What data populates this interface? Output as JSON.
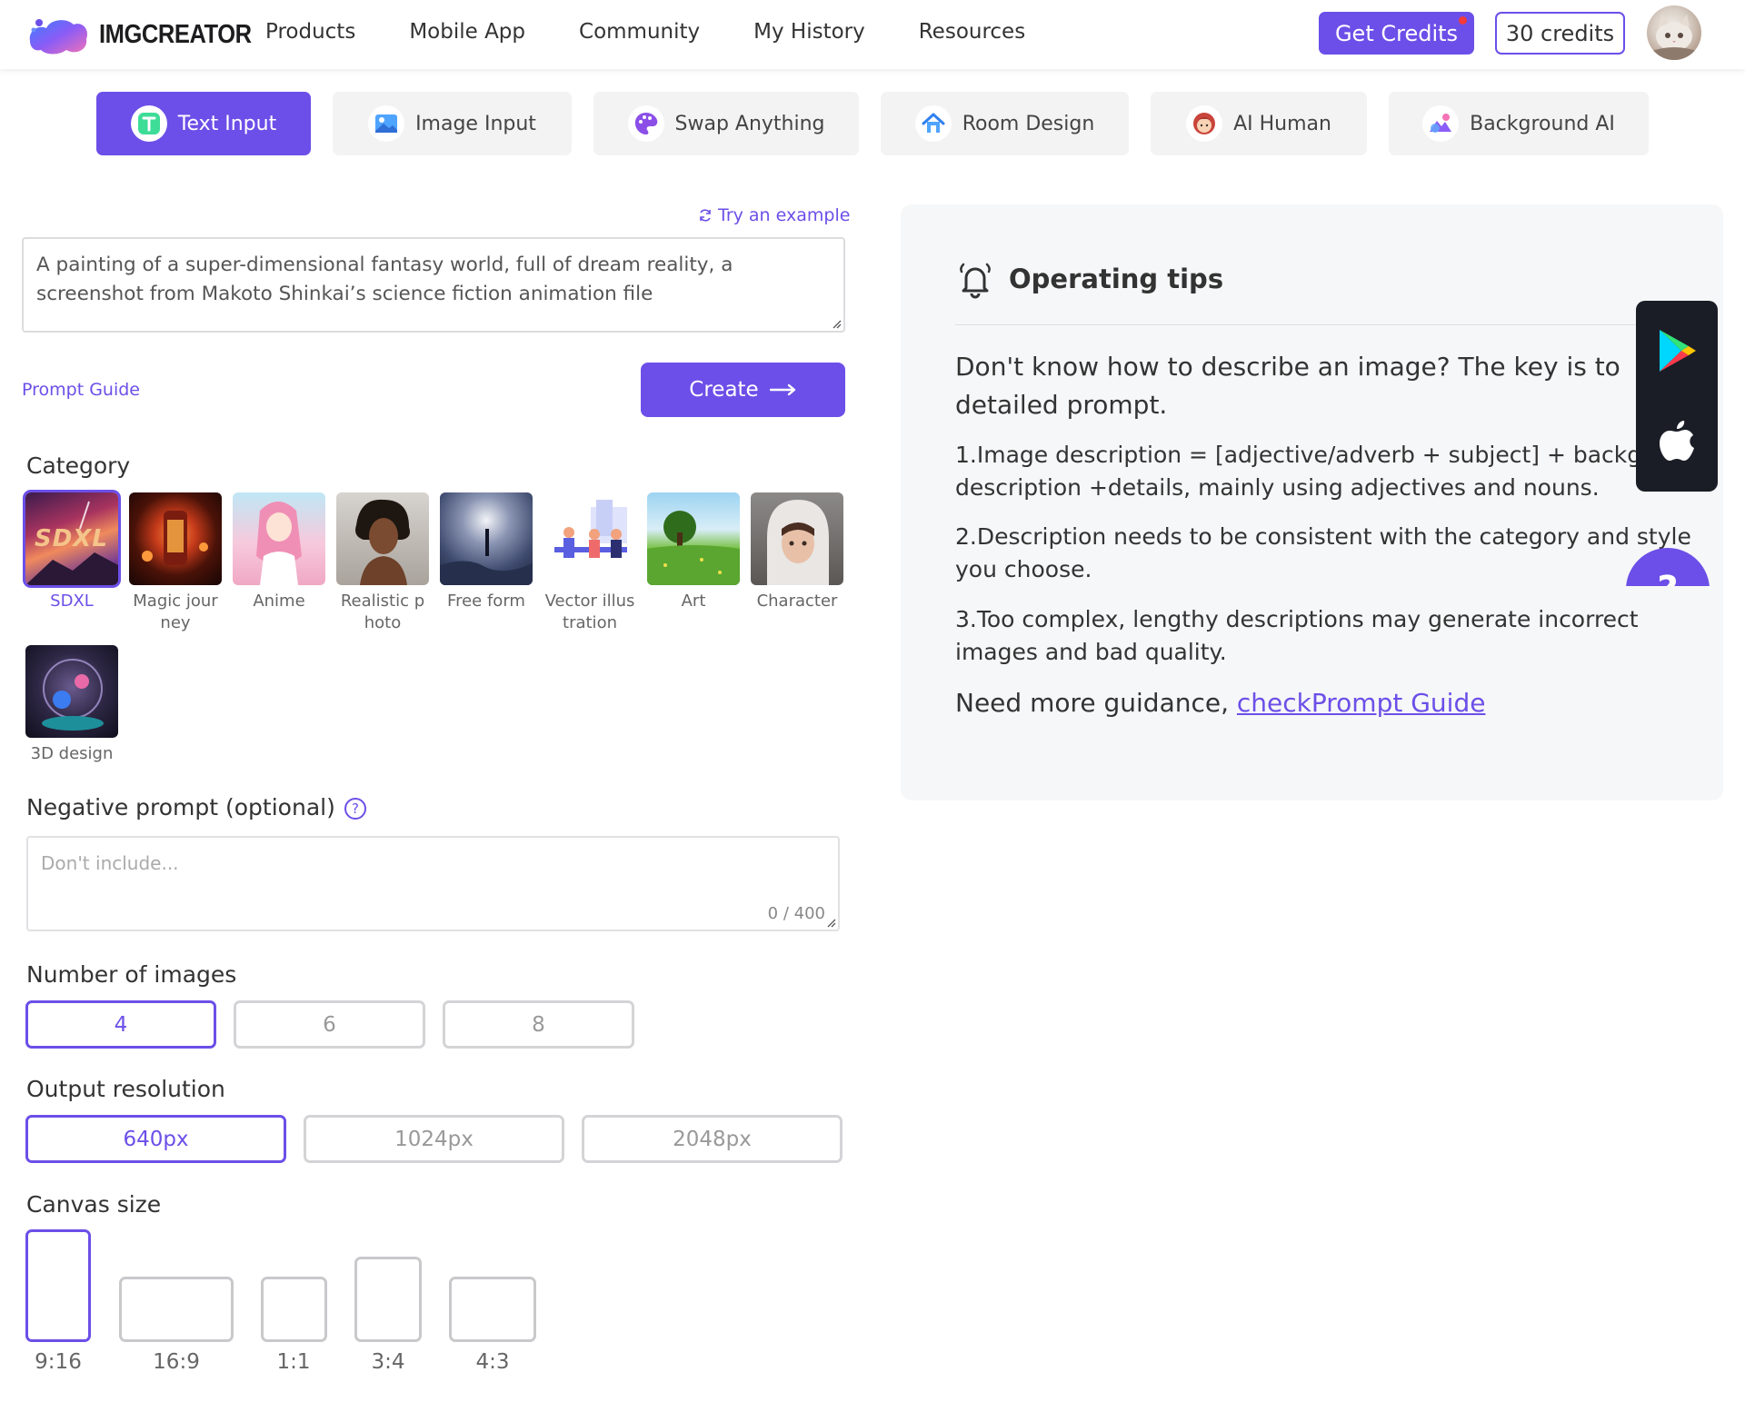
{
  "header": {
    "logo_text": "IMGCREATOR",
    "nav": [
      "Products",
      "Mobile App",
      "Community",
      "My History",
      "Resources"
    ],
    "get_credits": "Get Credits",
    "credits": "30 credits"
  },
  "tabs": [
    {
      "label": "Text Input",
      "icon": "text-input-icon",
      "active": true
    },
    {
      "label": "Image Input",
      "icon": "image-input-icon"
    },
    {
      "label": "Swap Anything",
      "icon": "palette-icon"
    },
    {
      "label": "Room Design",
      "icon": "house-icon"
    },
    {
      "label": "AI Human",
      "icon": "ai-human-icon"
    },
    {
      "label": "Background AI",
      "icon": "background-ai-icon"
    }
  ],
  "prompt": {
    "try_example": "Try an example",
    "text": "A painting of a super-dimensional fantasy world, full of dream reality, a screenshot from Makoto Shinkai’s science fiction animation file",
    "guide_link": "Prompt Guide",
    "create_label": "Create"
  },
  "category": {
    "label": "Category",
    "items": [
      {
        "label": "SDXL",
        "selected": true,
        "badge": "SDXL"
      },
      {
        "label": "Magic jour ney"
      },
      {
        "label": "Anime"
      },
      {
        "label": "Realistic p hoto"
      },
      {
        "label": "Free form"
      },
      {
        "label": "Vector illus tration"
      },
      {
        "label": "Art"
      },
      {
        "label": "Character"
      },
      {
        "label": "3D design"
      }
    ]
  },
  "negative": {
    "label": "Negative prompt (optional)",
    "help": "?",
    "placeholder": "Don't include...",
    "count": "0 / 400"
  },
  "num_images": {
    "label": "Number of images",
    "options": [
      "4",
      "6",
      "8"
    ],
    "selected": "4"
  },
  "resolution": {
    "label": "Output resolution",
    "options": [
      "640px",
      "1024px",
      "2048px"
    ],
    "selected": "640px"
  },
  "canvas": {
    "label": "Canvas size",
    "options": [
      "9:16",
      "16:9",
      "1:1",
      "3:4",
      "4:3"
    ],
    "selected": "9:16"
  },
  "tips": {
    "title": "Operating tips",
    "lead": "Don't know how to describe an image? The key is to write a detailed prompt.",
    "lead_line1": "Don't know how to describe an image? The key is to write a",
    "lead_line2": "detailed prompt.",
    "item1_line1": "1.Image description = [adjective/adverb + subject] + background",
    "item1_line2": "description +details, mainly using adjectives and nouns.",
    "item2_line1": "2.Description needs to be consistent with the category and style",
    "item2_line2": "you choose.",
    "item3_line1": "3.Too complex, lengthy descriptions may generate incorrect",
    "item3_line2": "images and bad quality.",
    "more_prefix": "Need more guidance, ",
    "more_link": "checkPrompt Guide"
  },
  "help_fab": "?"
}
